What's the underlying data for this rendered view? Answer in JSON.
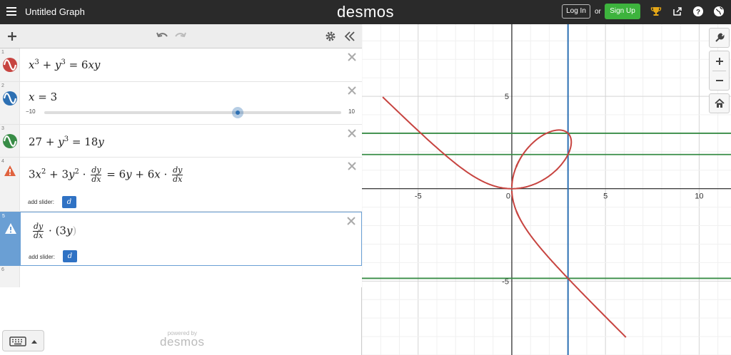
{
  "header": {
    "title": "Untitled Graph",
    "brand": "desmos",
    "login_label": "Log In",
    "or_label": "or",
    "signup_label": "Sign Up"
  },
  "expressions": [
    {
      "index": "1",
      "color": "#c74440",
      "type": "curve"
    },
    {
      "index": "2",
      "color": "#2d70b3",
      "type": "curve",
      "slider_min": "−10",
      "slider_max": "10",
      "slider_value": 3
    },
    {
      "index": "3",
      "color": "#388c46",
      "type": "curve"
    },
    {
      "index": "4",
      "type": "warning",
      "add_slider_label": "add slider:",
      "slider_var": "d"
    },
    {
      "index": "5",
      "type": "warning",
      "add_slider_label": "add slider:",
      "slider_var": "d"
    },
    {
      "index": "6",
      "type": "empty"
    }
  ],
  "footer": {
    "powered_by": "powered by",
    "brand": "desmos"
  },
  "colors": {
    "topbar": "#2a2a2a",
    "red": "#c74440",
    "blue": "#2d70b3",
    "green": "#388c46",
    "signup": "#3db33d",
    "warning": "#e0633f"
  },
  "graph": {
    "x_ticks": [
      "-5",
      "0",
      "5",
      "10"
    ],
    "y_ticks": [
      "5",
      "-5"
    ],
    "xlim": [
      -8,
      11.7
    ],
    "ylim": [
      -9,
      8.9
    ],
    "curve_a": 2,
    "vertical_line_x": 3,
    "horizontal_lines_y": [
      3,
      1.85,
      -4.85
    ]
  }
}
